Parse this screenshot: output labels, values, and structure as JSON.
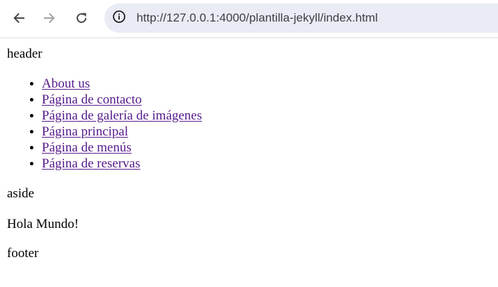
{
  "browser": {
    "url": "http://127.0.0.1:4000/plantilla-jekyll/index.html",
    "back_icon": "arrow-left-icon",
    "forward_icon": "arrow-right-icon",
    "reload_icon": "reload-icon",
    "site_info_icon": "info-icon"
  },
  "page": {
    "header": "header",
    "nav": [
      {
        "label": "About us"
      },
      {
        "label": "Página de contacto"
      },
      {
        "label": "Página de galería de imágenes"
      },
      {
        "label": "Página principal"
      },
      {
        "label": "Página de menús"
      },
      {
        "label": "Página de reservas"
      }
    ],
    "aside": "aside",
    "main_text": "Hola Mundo!",
    "footer": "footer"
  },
  "colors": {
    "link_visited": "#551a8b",
    "omnibox_bg": "#e9ebf5",
    "icon_active": "#474747",
    "icon_disabled": "#a3a3a3"
  }
}
